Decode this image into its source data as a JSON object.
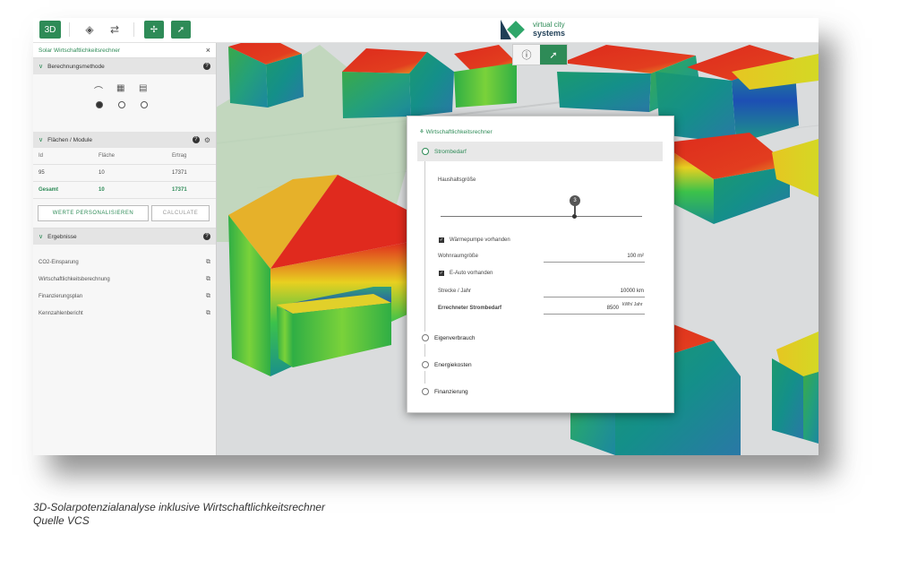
{
  "toolbar": {
    "btn_3d": "3D"
  },
  "logo": {
    "line1": "virtual city",
    "line2": "systems"
  },
  "sidebar": {
    "title": "Solar Wirtschaftlichkeitsrechner",
    "close": "×",
    "section_method": "Berechnungsmethode",
    "section_areas": "Flächen / Module",
    "table": {
      "headers": [
        "Id",
        "Fläche",
        "Ertrag"
      ],
      "rows": [
        [
          "95",
          "10",
          "17371"
        ]
      ],
      "total": [
        "Gesamt",
        "10",
        "17371"
      ]
    },
    "btn_personalize": "WERTE PERSONALISIEREN",
    "btn_calculate": "CALCULATE",
    "section_results": "Ergebnisse",
    "results": [
      "CO2-Einsparung",
      "Wirtschaftlichkeitsberechnung",
      "Finanzierungsplan",
      "Kennzahlenbericht"
    ]
  },
  "dialog": {
    "title": "Wirtschaftlichkeitsrechner",
    "sections": [
      "Strombedarf",
      "Eigenverbrauch",
      "Energiekosten",
      "Finanzierung"
    ],
    "household_label": "Haushaltsgröße",
    "household_value": "3",
    "heatpump_label": "Wärmepumpe vorhanden",
    "living_area_label": "Wohnraumgröße",
    "living_area_value": "100 m²",
    "ecar_label": "E-Auto vorhanden",
    "distance_label": "Strecke / Jahr",
    "distance_value": "10000 km",
    "demand_label": "Errechneter Strombedarf",
    "demand_value": "8500",
    "demand_unit": "kWh/ Jahr"
  },
  "caption": {
    "line1": "3D-Solarpotenzialanalyse inklusive Wirtschaftlichkeitsrechner",
    "line2": "Quelle VCS"
  }
}
